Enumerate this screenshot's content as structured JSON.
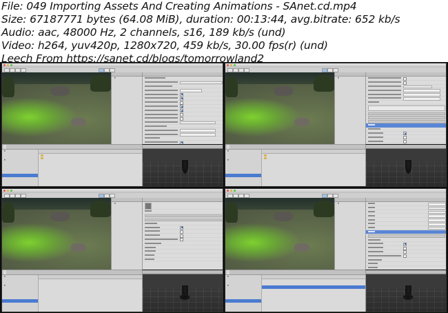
{
  "header": {
    "lines": [
      "File: 049 Importing Assets And Creating Animations - SAnet.cd.mp4",
      "Size: 67187771 bytes (64.08 MiB), duration: 00:13:44, avg.bitrate: 652 kb/s",
      "Audio: aac, 48000 Hz, 2 channels, s16, 189 kb/s (und)",
      "Video: h264, yuv420p, 1280x720, 459 kb/s, 30.00 fps(r) (und)",
      "Leech From https://sanet.cd/blogs/tomorrowland2"
    ]
  },
  "colors": {
    "grass": "#7ed12f",
    "selection": "#4a7bd0",
    "panel": "#d8d8d8",
    "frame_bg": "#0d0d0d"
  }
}
